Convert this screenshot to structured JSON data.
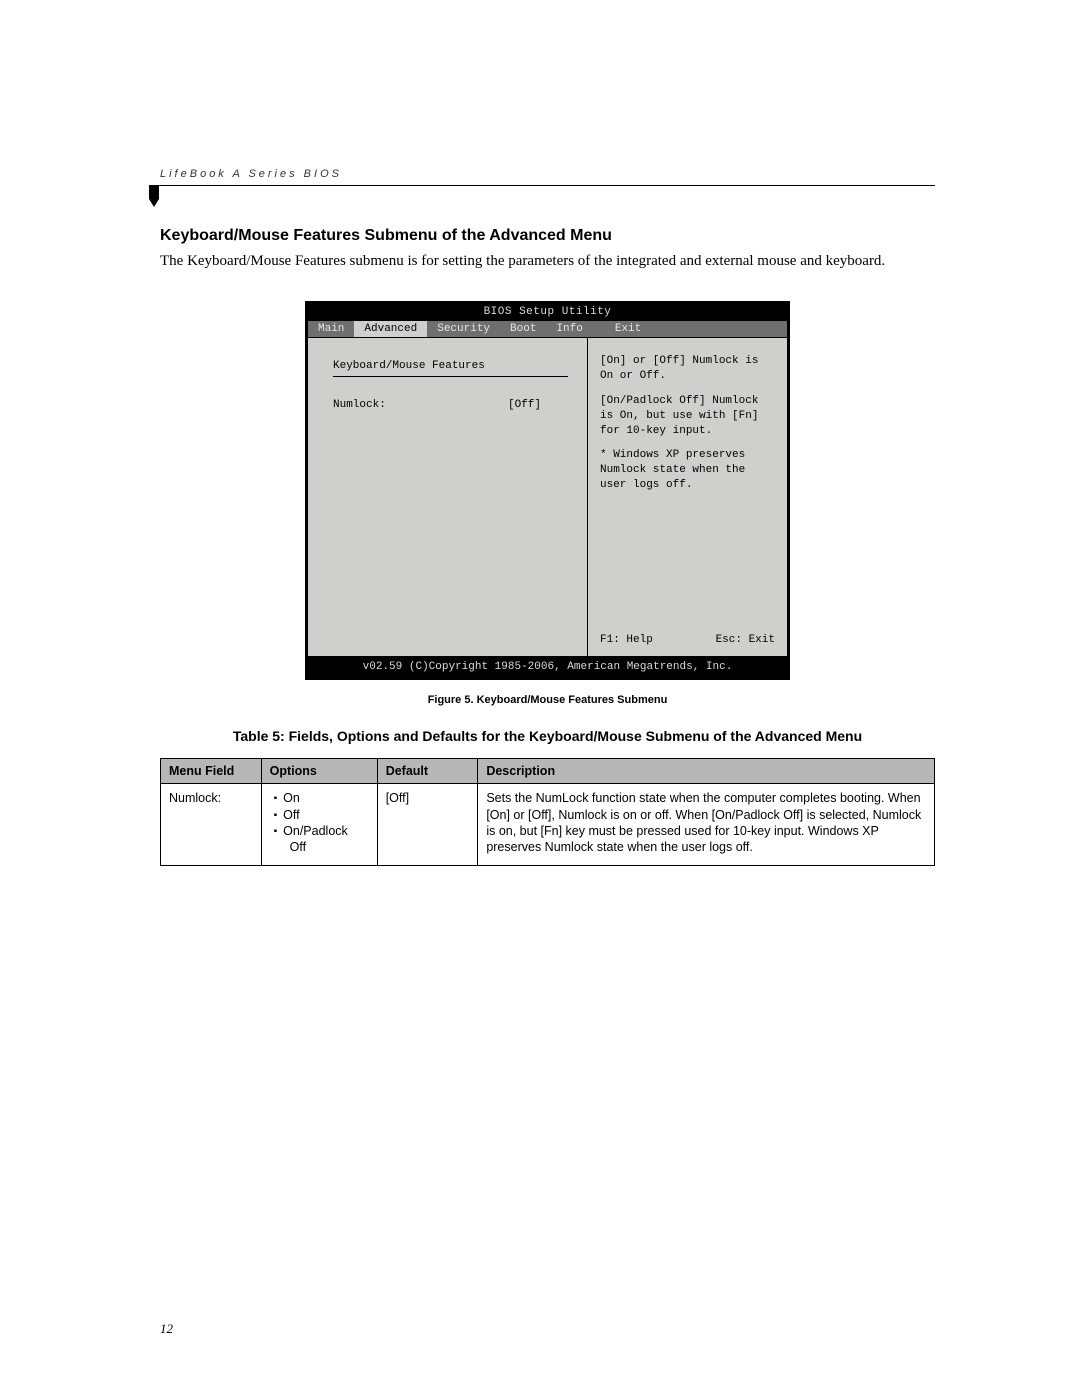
{
  "header": {
    "running": "LifeBook A Series BIOS"
  },
  "section": {
    "title": "Keyboard/Mouse Features Submenu of the Advanced Menu",
    "body": "The Keyboard/Mouse Features submenu is for setting the parameters of the integrated and external mouse and keyboard."
  },
  "bios": {
    "title": "BIOS Setup Utility",
    "tabs": {
      "main": "Main",
      "advanced": "Advanced",
      "security": "Security",
      "boot": "Boot",
      "info": "Info",
      "exit": "Exit"
    },
    "submenu_title": "Keyboard/Mouse Features",
    "field_label": "Numlock:",
    "field_value": "[Off]",
    "help": {
      "p1": "[On] or [Off] Numlock is On or Off.",
      "p2": "[On/Padlock Off] Numlock is On, but use with [Fn] for 10-key input.",
      "p3": "* Windows XP preserves Numlock state when the user logs off."
    },
    "keys": {
      "help": "F1: Help",
      "exit": "Esc: Exit"
    },
    "footer": "v02.59 (C)Copyright 1985-2006, American Megatrends, Inc."
  },
  "figure_caption": "Figure 5.  Keyboard/Mouse Features Submenu",
  "table": {
    "title": "Table 5: Fields, Options and Defaults for the Keyboard/Mouse Submenu of the Advanced Menu",
    "headers": {
      "field": "Menu Field",
      "options": "Options",
      "default": "Default",
      "description": "Description"
    },
    "row": {
      "field": "Numlock:",
      "options": {
        "o1": "On",
        "o2": "Off",
        "o3": "On/Padlock",
        "o3b": "Off"
      },
      "default": "[Off]",
      "description": "Sets the NumLock function state when the computer completes booting. When [On] or [Off], Numlock is on or off. When [On/Padlock Off] is selected, Numlock is on, but [Fn] key must be pressed used for 10-key input. Windows XP preserves Numlock state when the user logs off."
    }
  },
  "page_number": "12"
}
